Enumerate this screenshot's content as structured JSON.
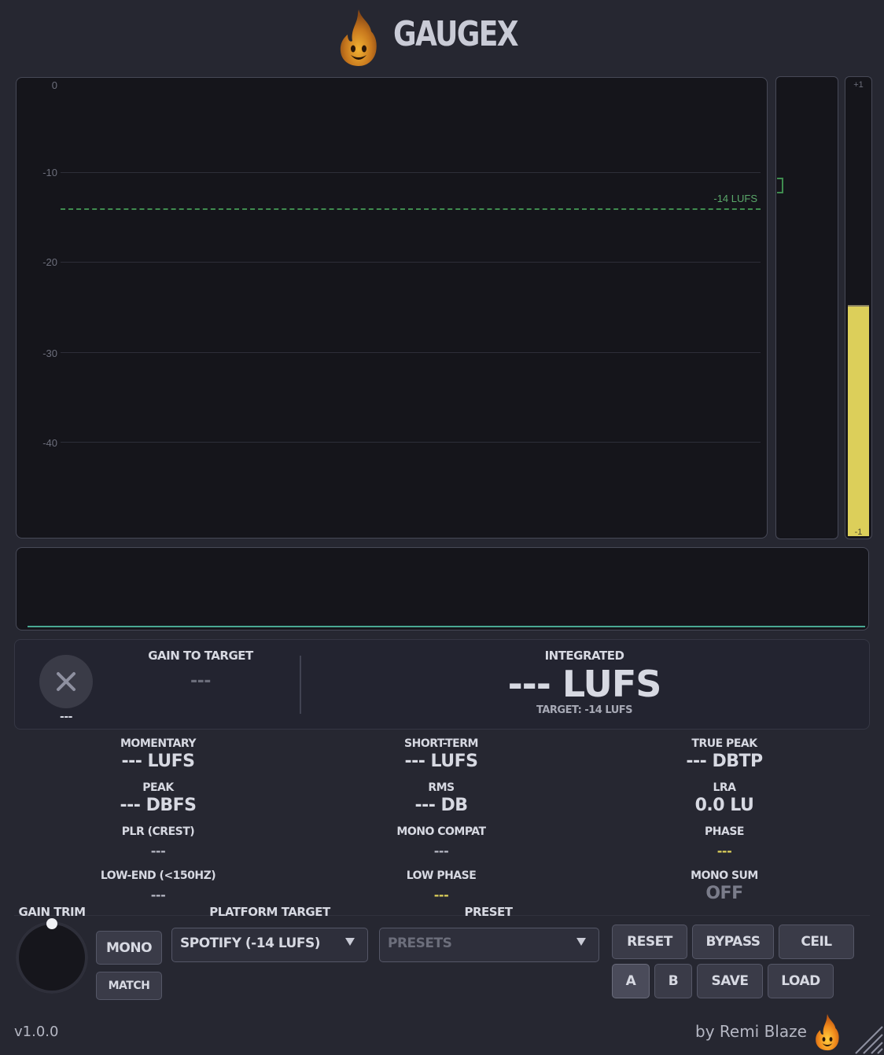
{
  "app": {
    "title": "GAUGEX",
    "version": "v1.0.0",
    "credit": "by Remi Blaze"
  },
  "graph": {
    "y_ticks": [
      "0",
      "-10",
      "-20",
      "-30",
      "-40"
    ],
    "target_label": "-14 LUFS"
  },
  "peak_meter": {
    "top_label": "+1",
    "bottom_label": "-1",
    "level_fraction": 0.5
  },
  "summary": {
    "clip_value": "---",
    "gain_to_target_label": "GAIN TO TARGET",
    "gain_to_target_value": "---",
    "integrated_label": "INTEGRATED",
    "integrated_value": "--- LUFS",
    "integrated_target": "TARGET: -14 LUFS"
  },
  "stats": [
    {
      "label": "MOMENTARY",
      "value": "--- LUFS"
    },
    {
      "label": "SHORT-TERM",
      "value": "--- LUFS"
    },
    {
      "label": "TRUE PEAK",
      "value": "--- DBTP"
    },
    {
      "label": "PEAK",
      "value": "--- DBFS"
    },
    {
      "label": "RMS",
      "value": "--- DB"
    },
    {
      "label": "LRA",
      "value": "0.0 LU"
    },
    {
      "label": "PLR (CREST)",
      "value": "---"
    },
    {
      "label": "MONO COMPAT",
      "value": "---"
    },
    {
      "label": "PHASE",
      "value": "---"
    },
    {
      "label": "LOW-END (<150HZ)",
      "value": "---"
    },
    {
      "label": "LOW PHASE",
      "value": "---"
    },
    {
      "label": "MONO SUM",
      "value": "OFF"
    }
  ],
  "controls": {
    "gain_trim_label": "GAIN TRIM",
    "mono_label": "MONO",
    "match_label": "MATCH",
    "platform_target_label": "PLATFORM TARGET",
    "platform_target_value": "SPOTIFY (-14 LUFS)",
    "preset_label": "PRESET",
    "preset_value": "PRESETS",
    "reset_label": "RESET",
    "bypass_label": "BYPASS",
    "ceil_label": "CEIL",
    "a_label": "A",
    "b_label": "B",
    "save_label": "SAVE",
    "load_label": "LOAD"
  },
  "colors": {
    "background": "#262731",
    "target_green": "#3f8c4f",
    "peak_yellow": "#dccf5a",
    "wave_teal": "#49a893"
  },
  "icons": [
    "flame-logo-icon",
    "close-icon",
    "chevron-down-icon",
    "resize-grip-icon"
  ]
}
